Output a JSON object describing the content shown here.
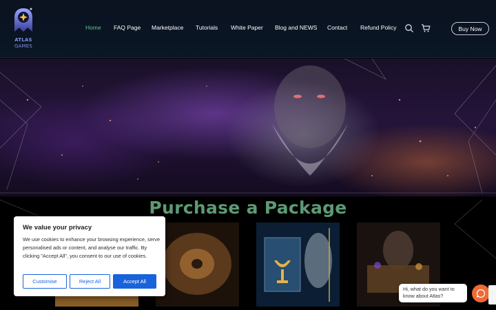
{
  "brand": {
    "logo_line1": "ATLAS",
    "logo_line2": "GAMES",
    "accent_color": "#4ecb8d",
    "logo_color": "#7f8fe0"
  },
  "nav": {
    "items": [
      {
        "label": "Home",
        "active": true
      },
      {
        "label": "FAQ Page",
        "active": false
      },
      {
        "label": "Marketplace",
        "active": false
      },
      {
        "label": "Tutorials",
        "active": false
      },
      {
        "label": "White Paper",
        "active": false
      },
      {
        "label": "Blog and NEWS",
        "active": false
      },
      {
        "label": "Contact",
        "active": false
      },
      {
        "label": "Refund Policy",
        "active": false
      }
    ],
    "search_icon": "search-icon",
    "cart_icon": "cart-icon",
    "buy_label": "Buy Now"
  },
  "section": {
    "title": "Purchase a Package",
    "title_color": "#5e9a74",
    "cards": [
      {
        "name": "package-card-1"
      },
      {
        "name": "package-card-2"
      },
      {
        "name": "package-card-3"
      },
      {
        "name": "package-card-4"
      }
    ]
  },
  "cookie": {
    "title": "We value your privacy",
    "body": "We use cookies to enhance your browsing experience, serve personalised ads or content, and analyse our traffic. By clicking \"Accept All\", you consent to our use of cookies.",
    "customise_label": "Customise",
    "reject_label": "Reject All",
    "accept_label": "Accept All",
    "button_color": "#1863dc"
  },
  "chat": {
    "prompt": "Hi, what do you want to know about Atlas?",
    "button_color": "#f06a35",
    "chat_icon": "chat-icon"
  }
}
